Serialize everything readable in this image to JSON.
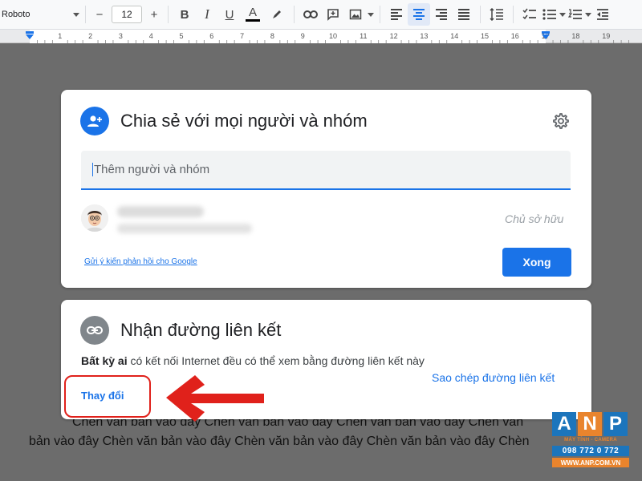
{
  "toolbar": {
    "font_name": "Roboto",
    "font_size": "12",
    "size_minus": "−",
    "size_plus": "+",
    "bold": "B",
    "italic": "I",
    "underline": "U",
    "text_color": "A",
    "accent": "#1a73e8"
  },
  "ruler": {
    "numbers": [
      "1",
      "2",
      "3",
      "4",
      "5",
      "6",
      "7",
      "8",
      "9",
      "10",
      "11",
      "12",
      "13",
      "14",
      "15",
      "16",
      "17",
      "18",
      "19"
    ]
  },
  "share_dialog": {
    "title": "Chia sẻ với mọi người và nhóm",
    "input_placeholder": "Thêm người và nhóm",
    "owner_role": "Chủ sở hữu",
    "feedback_link": "Gửi ý kiến phản hồi cho Google",
    "done_button": "Xong"
  },
  "link_dialog": {
    "title": "Nhận đường liên kết",
    "desc_bold": "Bất kỳ ai",
    "desc_rest": " có kết nối Internet đều có thể xem bằng đường liên kết này",
    "change_link": "Thay đổi",
    "copy_link": "Sao chép đường liên kết"
  },
  "document": {
    "line1": "Chèn văn bản vào đây Chèn văn bản vào đây Chèn văn bản vào đây Chèn văn",
    "line2": "bản vào đây Chèn văn bản vào đây Chèn văn bản vào đây Chèn văn bản vào đây Chèn"
  },
  "watermark": {
    "letters": [
      "A",
      "N",
      "P"
    ],
    "letter_colors": [
      "#1c75bc",
      "#e9842d",
      "#1c75bc"
    ],
    "tagline": "MÁY TÍNH - CAMERA",
    "phone": "098 772 0 772",
    "website": "WWW.ANP.COM.VN"
  },
  "colors": {
    "primary": "#1a73e8",
    "annotation_red": "#e0211b"
  }
}
